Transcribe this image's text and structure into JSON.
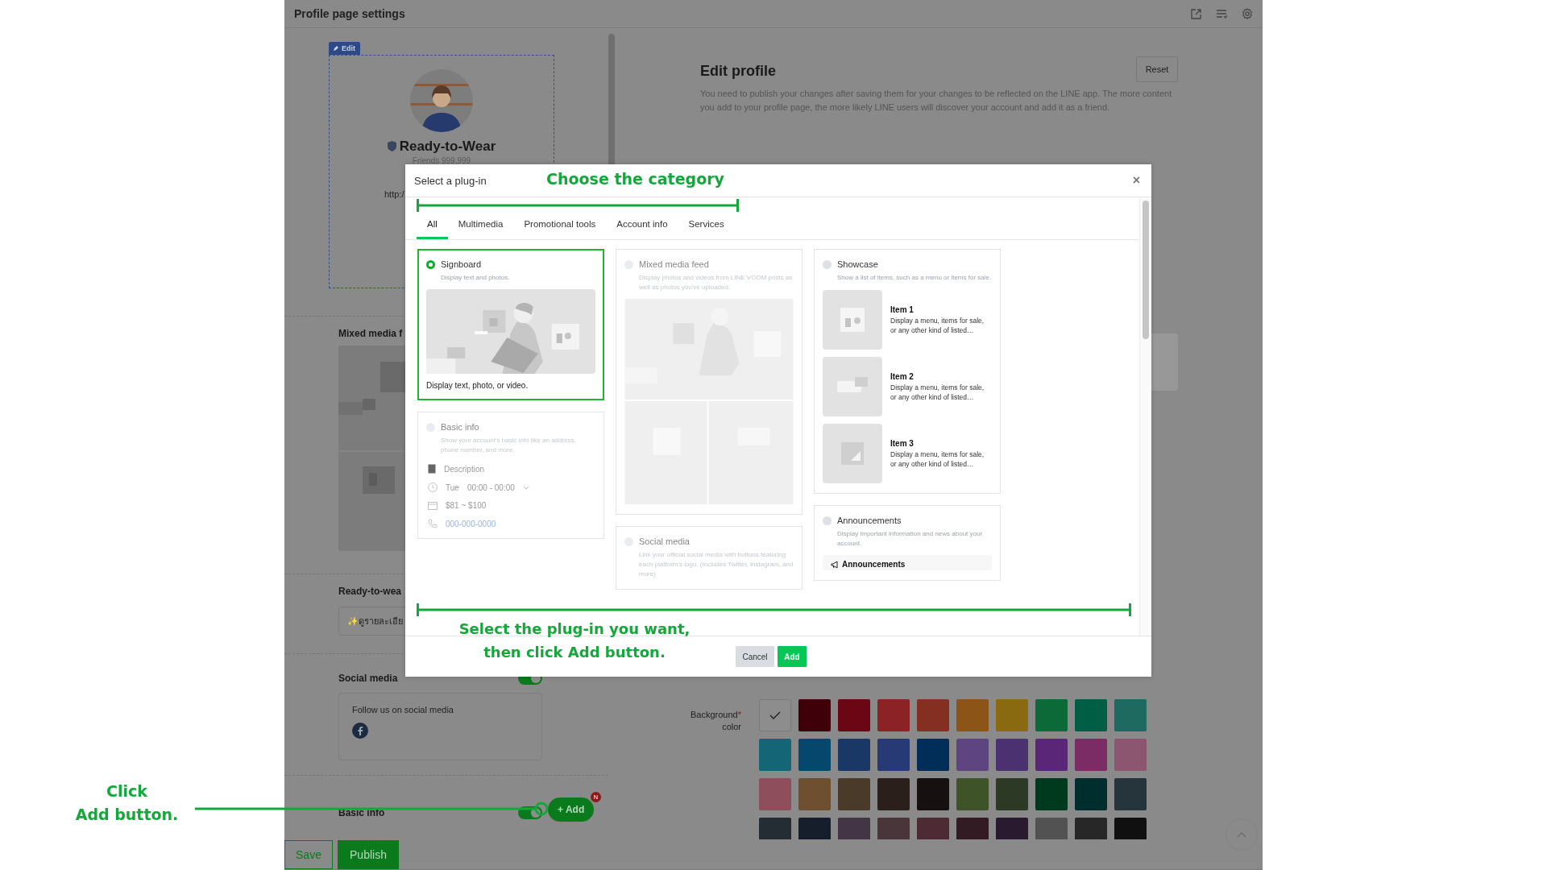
{
  "header": {
    "title": "Profile page settings"
  },
  "preview": {
    "edit_label": "Edit",
    "name": "Ready-to-Wear",
    "friends": "Friends 999,999",
    "link": "http:/"
  },
  "left_sections": [
    {
      "kind": "media",
      "title": "Mixed media f"
    },
    {
      "kind": "field",
      "title": "Ready-to-wea",
      "value": "✨ดูรายละเอีย"
    },
    {
      "kind": "social",
      "title": "Social media",
      "on": true,
      "link_label": "Follow us on social media"
    },
    {
      "kind": "toggle",
      "title": "Basic info",
      "on": true
    }
  ],
  "add_button": {
    "label": "+ Add",
    "badge": "N"
  },
  "footer_buttons": [
    {
      "label": "Save",
      "kind": "outline"
    },
    {
      "label": "Publish",
      "kind": "primary"
    }
  ],
  "edit_profile": {
    "title": "Edit profile",
    "reset": "Reset",
    "description": "You need to publish your changes after saving them for your changes to be reflected on the LINE app. The more content you add to your profile page, the more likely LINE users will discover your account and add it as a friend."
  },
  "background_color": {
    "label": "Background",
    "required_mark": "*",
    "label_2": "color",
    "swatches": [
      {
        "color": "#8d8d8d",
        "selected": true
      },
      {
        "color": "#3f0009",
        "selected": false
      },
      {
        "color": "#6b0614",
        "selected": false
      },
      {
        "color": "#8a2226",
        "selected": false
      },
      {
        "color": "#852f22",
        "selected": false
      },
      {
        "color": "#8c5416",
        "selected": false
      },
      {
        "color": "#8a6a10",
        "selected": false
      },
      {
        "color": "#0c6a38",
        "selected": false
      },
      {
        "color": "#005e44",
        "selected": false
      },
      {
        "color": "#1f6a60",
        "selected": false
      },
      {
        "color": "#146676",
        "selected": false
      },
      {
        "color": "#06476d",
        "selected": false
      },
      {
        "color": "#1a3865",
        "selected": false
      },
      {
        "color": "#283a75",
        "selected": false
      },
      {
        "color": "#002e58",
        "selected": false
      },
      {
        "color": "#5e4580",
        "selected": false
      },
      {
        "color": "#4b3170",
        "selected": false
      },
      {
        "color": "#5a2778",
        "selected": false
      },
      {
        "color": "#7b2c64",
        "selected": false
      },
      {
        "color": "#8c5670",
        "selected": false
      },
      {
        "color": "#8e4e5c",
        "selected": false
      },
      {
        "color": "#6e4f2f",
        "selected": false
      },
      {
        "color": "#4a3a2a",
        "selected": false
      },
      {
        "color": "#2b1f1b",
        "selected": false
      },
      {
        "color": "#161110",
        "selected": false
      },
      {
        "color": "#3e5428",
        "selected": false
      },
      {
        "color": "#2c3a25",
        "selected": false
      },
      {
        "color": "#003a1e",
        "selected": false
      },
      {
        "color": "#002e2e",
        "selected": false
      },
      {
        "color": "#26343c",
        "selected": false
      },
      {
        "color": "#232d33",
        "selected": false
      },
      {
        "color": "#171e2b",
        "selected": false
      },
      {
        "color": "#433446",
        "selected": false
      },
      {
        "color": "#48363b",
        "selected": false
      },
      {
        "color": "#4d2b34",
        "selected": false
      },
      {
        "color": "#321b22",
        "selected": false
      },
      {
        "color": "#2a1a30",
        "selected": false
      },
      {
        "color": "#525252",
        "selected": false
      },
      {
        "color": "#272727",
        "selected": false
      },
      {
        "color": "#101010",
        "selected": false
      }
    ]
  },
  "modal": {
    "title": "Select a plug-in",
    "close": "×",
    "tabs": [
      {
        "label": "All",
        "selected": true
      },
      {
        "label": "Multimedia",
        "selected": false
      },
      {
        "label": "Promotional tools",
        "selected": false
      },
      {
        "label": "Account info",
        "selected": false
      },
      {
        "label": "Services",
        "selected": false
      }
    ],
    "columns": [
      [
        {
          "kind": "signboard",
          "title": "Signboard",
          "description": "Display text and photos.",
          "selected": true,
          "disabled": false,
          "caption": "Display text, photo, or video."
        },
        {
          "kind": "basic_info",
          "title": "Basic info",
          "description": "Show your account's basic info like an address, phone number, and more.",
          "selected": false,
          "disabled": true,
          "rows": [
            {
              "kind": "description",
              "text": "Description"
            },
            {
              "kind": "hours",
              "day": "Tue",
              "text": "00:00 - 00:00"
            },
            {
              "kind": "price",
              "text": "$81 ~ $100"
            },
            {
              "kind": "phone",
              "text": "000-000-0000"
            }
          ]
        }
      ],
      [
        {
          "kind": "mixed_media",
          "title": "Mixed media feed",
          "description": "Display photos and videos from LINE VOOM posts as well as photos you've uploaded.",
          "selected": false,
          "disabled": true
        },
        {
          "kind": "social",
          "title": "Social media",
          "description": "Link your official social media with buttons featuring each platform's logo. (Includes Twitter, Instagram, and more)",
          "selected": false,
          "disabled": true
        }
      ],
      [
        {
          "kind": "showcase",
          "title": "Showcase",
          "description": "Show a list of items, such as a menu or items for sale.",
          "selected": false,
          "disabled": false,
          "items": [
            {
              "title": "Item 1",
              "text": "Display a menu, items for sale, or any other kind of listed…"
            },
            {
              "title": "Item 2",
              "text": "Display a menu, items for sale, or any other kind of listed…"
            },
            {
              "title": "Item 3",
              "text": "Display a menu, items for sale, or any other kind of listed…"
            }
          ]
        },
        {
          "kind": "announcements",
          "title": "Announcements",
          "description": "Display important information and news about your account.",
          "selected": false,
          "disabled": false,
          "preview_title": "Announcements"
        }
      ]
    ],
    "buttons": [
      {
        "label": "Cancel",
        "kind": "secondary"
      },
      {
        "label": "Add",
        "kind": "primary"
      }
    ]
  },
  "annotations": [
    {
      "kind": "top",
      "text": "Choose the category"
    },
    {
      "kind": "bottom",
      "text": "Select the plug-in you want,\nthen click Add button."
    },
    {
      "kind": "pointer",
      "text": "Click\nAdd button."
    }
  ]
}
